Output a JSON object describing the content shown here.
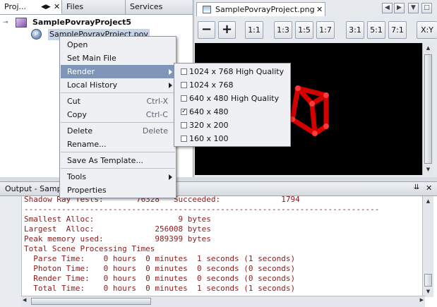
{
  "projects_panel": {
    "tabs": [
      "Proj...",
      "Files",
      "Services"
    ],
    "project_name": "SamplePovrayProject5",
    "file_name": "SamplePovrayProject.pov"
  },
  "editor": {
    "tab_label": "SamplePovrayProject.png",
    "zoom_out": "−",
    "zoom_in": "+",
    "zoom_buttons": [
      "1:1",
      "1:3",
      "1:5",
      "1:7",
      "3:1",
      "5:1",
      "7:1",
      "X:Y"
    ]
  },
  "output": {
    "title": "Output - SamplePovrayProject5 (Render) ",
    "lines": [
      "Shadow Ray Tests:       76328   Succeeded:             1794",
      "----------------------------------------------------------------------------",
      "Smallest Alloc:                  9 bytes",
      "Largest  Alloc:             256008 bytes",
      "Peak memory used:           989399 bytes",
      "Total Scene Processing Times",
      "  Parse Time:    0 hours  0 minutes  1 seconds (1 seconds)",
      "  Photon Time:   0 hours  0 minutes  0 seconds (0 seconds)",
      "  Render Time:   0 hours  0 minutes  0 seconds (0 seconds)",
      "  Total Time:    0 hours  0 minutes  1 seconds (1 seconds)"
    ]
  },
  "context_menu": {
    "open": "Open",
    "set_main_file": "Set Main File",
    "render": "Render",
    "local_history": "Local History",
    "cut": "Cut",
    "cut_shortcut": "Ctrl-X",
    "copy": "Copy",
    "copy_shortcut": "Ctrl-C",
    "delete": "Delete",
    "delete_shortcut": "Delete",
    "rename": "Rename...",
    "save_as_template": "Save As Template...",
    "tools": "Tools",
    "properties": "Properties"
  },
  "render_submenu": {
    "items": [
      {
        "label": "1024 x 768 High Quality",
        "checked": false
      },
      {
        "label": "1024 x 768",
        "checked": false
      },
      {
        "label": "640 x 480 High Quality",
        "checked": false
      },
      {
        "label": "640 x 480",
        "checked": true
      },
      {
        "label": "320 x 200",
        "checked": false
      },
      {
        "label": "160 x 100",
        "checked": false
      }
    ]
  },
  "colors": {
    "menu_highlight": "#7f96b8",
    "output_text": "#8b1a1a",
    "render_object": "#d40000"
  }
}
